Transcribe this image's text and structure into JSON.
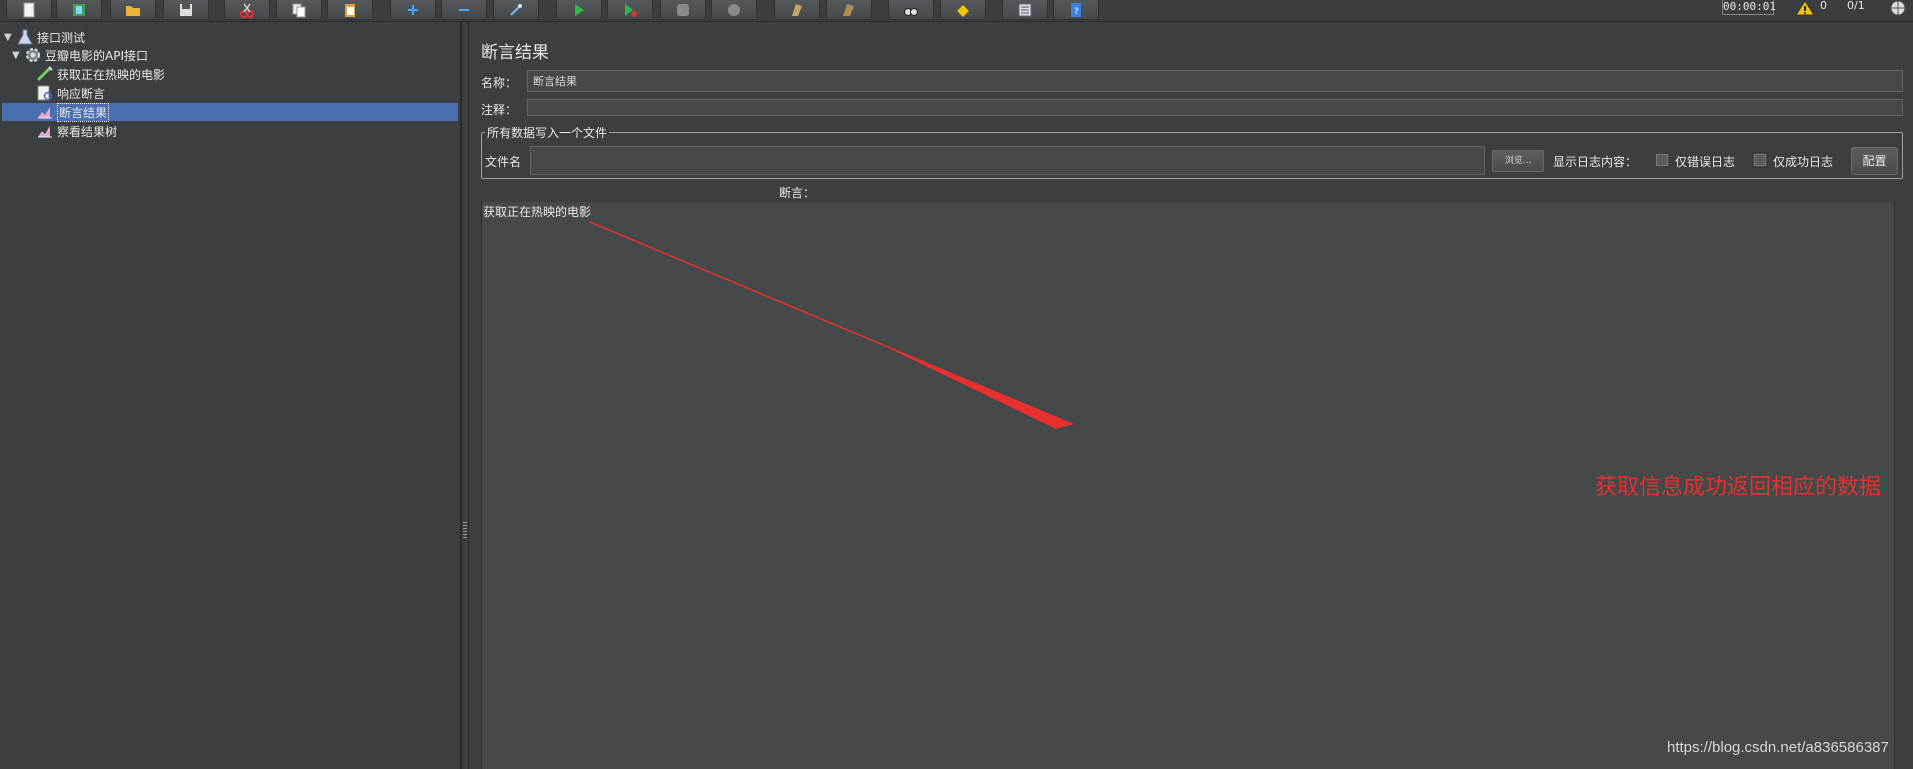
{
  "toolbar": {
    "buttons": [
      {
        "name": "new-icon"
      },
      {
        "name": "templates-icon"
      },
      {
        "name": "open-icon"
      },
      {
        "name": "save-icon"
      },
      {
        "name": "cut-icon"
      },
      {
        "name": "copy-icon"
      },
      {
        "name": "paste-icon"
      },
      {
        "name": "expand-icon"
      },
      {
        "name": "collapse-icon"
      },
      {
        "name": "toggle-icon"
      },
      {
        "name": "start-icon"
      },
      {
        "name": "start-no-pause-icon"
      },
      {
        "name": "stop-icon"
      },
      {
        "name": "shutdown-icon"
      },
      {
        "name": "clear-icon"
      },
      {
        "name": "clear-all-icon"
      },
      {
        "name": "search-icon"
      },
      {
        "name": "reset-search-icon"
      },
      {
        "name": "function-helper-icon"
      },
      {
        "name": "help-icon"
      }
    ],
    "timer": "00:00:01",
    "warning_count": "0",
    "threads": "0/1"
  },
  "tree": {
    "items": [
      {
        "label": "接口测试",
        "icon": "test-plan-icon",
        "expanded": true,
        "level": 0
      },
      {
        "label": "豆瓣电影的API接口",
        "icon": "thread-group-icon",
        "expanded": true,
        "level": 1
      },
      {
        "label": "获取正在热映的电影",
        "icon": "http-sampler-icon",
        "level": 2
      },
      {
        "label": "响应断言",
        "icon": "assertion-icon",
        "level": 2
      },
      {
        "label": "断言结果",
        "icon": "listener-icon",
        "level": 2,
        "selected": true
      },
      {
        "label": "察看结果树",
        "icon": "listener-icon",
        "level": 2
      }
    ]
  },
  "panel": {
    "title": "断言结果",
    "name_label": "名称：",
    "name_value": "断言结果",
    "comment_label": "注释：",
    "comment_value": "",
    "fieldset_legend": "所有数据写入一个文件",
    "filename_label": "文件名",
    "filename_value": "",
    "browse_label": "浏览...",
    "log_content_label": "显示日志内容：",
    "errors_only_label": "仅错误日志",
    "success_only_label": "仅成功日志",
    "config_label": "配置",
    "assertion_header": "断言：",
    "results": [
      "获取正在热映的电影"
    ]
  },
  "annotation": {
    "text": "获取信息成功返回相应的数据",
    "color": "#e8302f"
  },
  "watermark": "https://blog.csdn.net/a836586387",
  "colors": {
    "background": "#3c3f41",
    "field": "#45494a",
    "selection": "#4b6eaf"
  }
}
